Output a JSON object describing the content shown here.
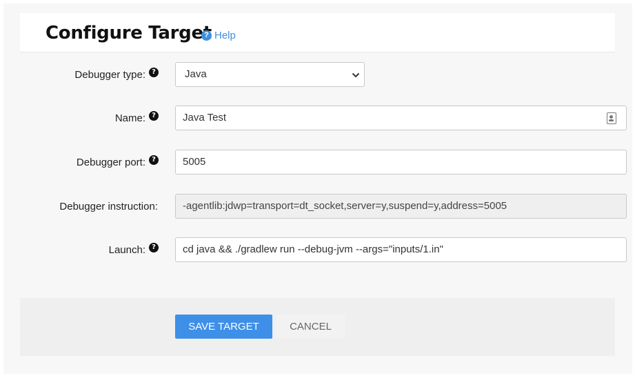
{
  "header": {
    "title": "Configure Target",
    "help_label": "Help",
    "help_icon": "question-circle-icon"
  },
  "form": {
    "debugger_type": {
      "label": "Debugger type:",
      "value": "Java"
    },
    "name": {
      "label": "Name:",
      "value": "Java Test"
    },
    "debugger_port": {
      "label": "Debugger port:",
      "value": "5005"
    },
    "debugger_instruction": {
      "label": "Debugger instruction:",
      "value": "-agentlib:jdwp=transport=dt_socket,server=y,suspend=y,address=5005"
    },
    "launch": {
      "label": "Launch:",
      "value": "cd java && ./gradlew run --debug-jvm --args=\"inputs/1.in\""
    }
  },
  "actions": {
    "save_label": "Save Target",
    "cancel_label": "Cancel"
  },
  "colors": {
    "accent": "#3d8fe8",
    "panel_bg": "#f7f7f7",
    "footer_bg": "#efefef"
  }
}
